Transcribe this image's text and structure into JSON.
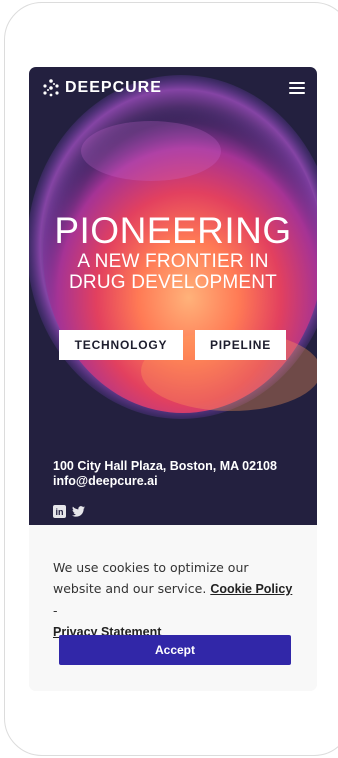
{
  "header": {
    "logo_text": "DEEPCURE",
    "logo_icon": "molecule-icon",
    "menu_icon": "hamburger-menu-icon"
  },
  "hero": {
    "title_line1": "PIONEERING",
    "title_line2": "A NEW FRONTIER IN",
    "title_line3": "DRUG DEVELOPMENT",
    "buttons": {
      "technology": "TECHNOLOGY",
      "pipeline": "PIPELINE"
    }
  },
  "contact": {
    "address": "100 City Hall Plaza, Boston, MA 02108",
    "email": "info@deepcure.ai",
    "linkedin_label": "in",
    "twitter_label": "🐦"
  },
  "cookie_banner": {
    "text_before": "We use cookies to optimize our website and our service.",
    "cookie_policy_link": "Cookie Policy",
    "separator": "-",
    "privacy_link": "Privacy Statement",
    "accept_label": "Accept"
  },
  "colors": {
    "hero_background": "#23203f",
    "accept_button": "#3127a8",
    "banner_background": "#f8f8f8"
  }
}
